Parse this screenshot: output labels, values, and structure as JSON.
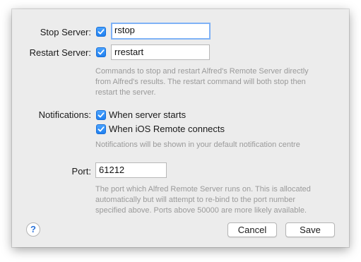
{
  "stop_server": {
    "label": "Stop Server:",
    "checked": true,
    "value": "rstop"
  },
  "restart_server": {
    "label": "Restart Server:",
    "checked": true,
    "value": "rrestart"
  },
  "commands_help": [
    "Commands to stop and restart Alfred's Remote Server directly",
    "from Alfred's results. The restart command will both stop then",
    "restart the server."
  ],
  "notifications": {
    "label": "Notifications:",
    "options": [
      {
        "label": "When server starts",
        "checked": true
      },
      {
        "label": "When iOS Remote connects",
        "checked": true
      }
    ],
    "help": "Notifications will be shown in your default notification centre"
  },
  "port": {
    "label": "Port:",
    "value": "61212",
    "help": [
      "The port which Alfred Remote Server runs on. This is allocated",
      "automatically but will attempt to re-bind to the port number",
      "specified above. Ports above 50000 are more likely available."
    ]
  },
  "buttons": {
    "help": "?",
    "cancel": "Cancel",
    "save": "Save"
  },
  "colors": {
    "accent": "#1f7ff0",
    "sheet_bg": "#ececec",
    "help_text": "#9a9a9a"
  }
}
